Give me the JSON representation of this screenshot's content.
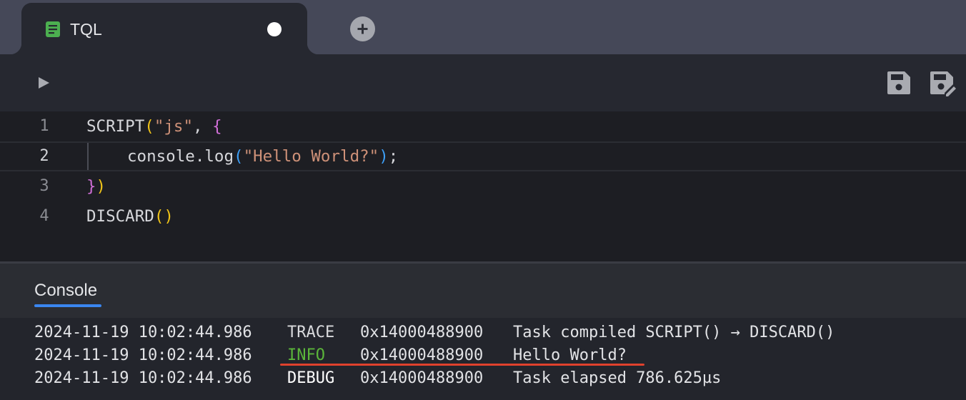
{
  "tabs": [
    {
      "label": "TQL",
      "icon": "document-icon",
      "unsaved": true
    }
  ],
  "editor": {
    "lines": [
      {
        "number": "1"
      },
      {
        "number": "2"
      },
      {
        "number": "3"
      },
      {
        "number": "4"
      }
    ],
    "code": {
      "l1_fn": "SCRIPT",
      "l1_open": "(",
      "l1_str": "\"js\"",
      "l1_sep": ", ",
      "l1_brace": "{",
      "l2_fn": "console.log",
      "l2_open": "(",
      "l2_str": "\"Hello World?\"",
      "l2_close": ")",
      "l2_end": ";",
      "l3_brace": "}",
      "l3_close": ")",
      "l4_fn": "DISCARD",
      "l4_parens": "()"
    }
  },
  "console": {
    "tab_label": "Console",
    "logs": [
      {
        "time": "2024-11-19 10:02:44.986",
        "level": "TRACE",
        "task": "0x14000488900",
        "message": "Task compiled SCRIPT() → DISCARD()"
      },
      {
        "time": "2024-11-19 10:02:44.986",
        "level": "INFO",
        "task": "0x14000488900",
        "message": "Hello World?"
      },
      {
        "time": "2024-11-19 10:02:44.986",
        "level": "DEBUG",
        "task": "0x14000488900",
        "message": "Task elapsed 786.625µs"
      }
    ]
  },
  "colors": {
    "accent": "#3a86f0",
    "info": "#5bb53a",
    "highlight": "#e0412d",
    "tab_icon": "#4caf50"
  }
}
